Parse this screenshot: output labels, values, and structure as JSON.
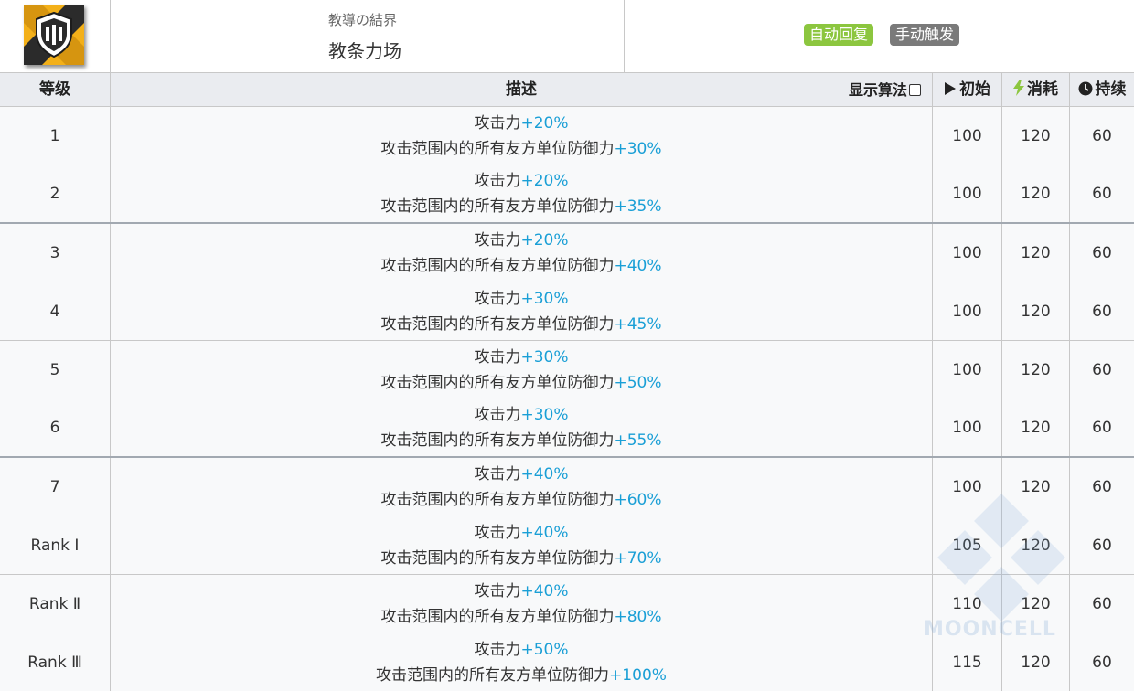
{
  "skill": {
    "name_jp": "教導の結界",
    "name_cn": "教条力场",
    "tags": {
      "auto": "自动回复",
      "manual": "手动触发"
    },
    "icon": "shield-skill-icon"
  },
  "table": {
    "headers": {
      "level": "等级",
      "desc": "描述",
      "formula_toggle": "显示算法",
      "init": "初始",
      "cost": "消耗",
      "duration": "持续"
    },
    "rows": [
      {
        "level": "1",
        "atk_label": "攻击力",
        "atk": "+20%",
        "def_label": "攻击范围内的所有友方单位防御力",
        "def": "+30%",
        "init": "100",
        "cost": "120",
        "dur": "60"
      },
      {
        "level": "2",
        "atk_label": "攻击力",
        "atk": "+20%",
        "def_label": "攻击范围内的所有友方单位防御力",
        "def": "+35%",
        "init": "100",
        "cost": "120",
        "dur": "60"
      },
      {
        "level": "3",
        "atk_label": "攻击力",
        "atk": "+20%",
        "def_label": "攻击范围内的所有友方单位防御力",
        "def": "+40%",
        "init": "100",
        "cost": "120",
        "dur": "60"
      },
      {
        "level": "4",
        "atk_label": "攻击力",
        "atk": "+30%",
        "def_label": "攻击范围内的所有友方单位防御力",
        "def": "+45%",
        "init": "100",
        "cost": "120",
        "dur": "60"
      },
      {
        "level": "5",
        "atk_label": "攻击力",
        "atk": "+30%",
        "def_label": "攻击范围内的所有友方单位防御力",
        "def": "+50%",
        "init": "100",
        "cost": "120",
        "dur": "60"
      },
      {
        "level": "6",
        "atk_label": "攻击力",
        "atk": "+30%",
        "def_label": "攻击范围内的所有友方单位防御力",
        "def": "+55%",
        "init": "100",
        "cost": "120",
        "dur": "60"
      },
      {
        "level": "7",
        "atk_label": "攻击力",
        "atk": "+40%",
        "def_label": "攻击范围内的所有友方单位防御力",
        "def": "+60%",
        "init": "100",
        "cost": "120",
        "dur": "60"
      },
      {
        "level": "Rank Ⅰ",
        "atk_label": "攻击力",
        "atk": "+40%",
        "def_label": "攻击范围内的所有友方单位防御力",
        "def": "+70%",
        "init": "105",
        "cost": "120",
        "dur": "60"
      },
      {
        "level": "Rank Ⅱ",
        "atk_label": "攻击力",
        "atk": "+40%",
        "def_label": "攻击范围内的所有友方单位防御力",
        "def": "+80%",
        "init": "110",
        "cost": "120",
        "dur": "60"
      },
      {
        "level": "Rank Ⅲ",
        "atk_label": "攻击力",
        "atk": "+50%",
        "def_label": "攻击范围内的所有友方单位防御力",
        "def": "+100%",
        "init": "115",
        "cost": "120",
        "dur": "60"
      }
    ]
  },
  "watermark": "MOONCELL",
  "colors": {
    "highlight": "#1a9fd6",
    "tag_auto": "#8cc63f",
    "tag_manual": "#7a7a7a",
    "header_bg": "#eaecf0",
    "row_bg": "#f8f9fa"
  }
}
